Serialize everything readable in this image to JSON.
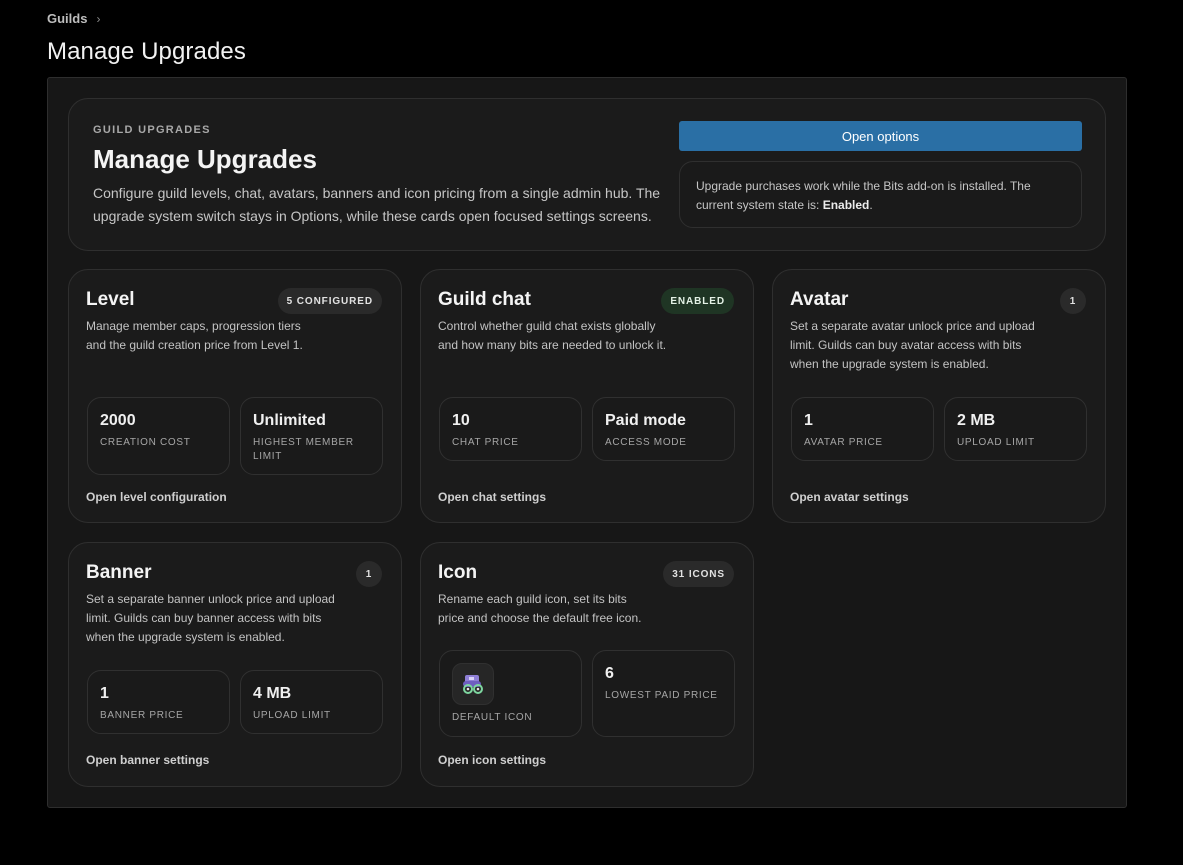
{
  "breadcrumb": {
    "root": "Guilds"
  },
  "page_title": "Manage Upgrades",
  "hero": {
    "eyebrow": "GUILD UPGRADES",
    "title": "Manage Upgrades",
    "description": "Configure guild levels, chat, avatars, banners and icon pricing from a single admin hub. The upgrade system switch stays in Options, while these cards open focused settings screens.",
    "options_button": "Open options",
    "state_text": "Upgrade purchases work while the Bits add-on is installed. The current system state is: ",
    "state_value": "Enabled",
    "state_suffix": "."
  },
  "cards": {
    "level": {
      "title": "Level",
      "badge": "5 CONFIGURED",
      "description": "Manage member caps, progression tiers and the guild creation price from Level 1.",
      "stat1_value": "2000",
      "stat1_label": "CREATION COST",
      "stat2_value": "Unlimited",
      "stat2_label": "HIGHEST MEMBER LIMIT",
      "link": "Open level configuration"
    },
    "chat": {
      "title": "Guild chat",
      "badge": "ENABLED",
      "description": "Control whether guild chat exists globally and how many bits are needed to unlock it.",
      "stat1_value": "10",
      "stat1_label": "CHAT PRICE",
      "stat2_value": "Paid mode",
      "stat2_label": "ACCESS MODE",
      "link": "Open chat settings"
    },
    "avatar": {
      "title": "Avatar",
      "badge": "1",
      "description": "Set a separate avatar unlock price and upload limit. Guilds can buy avatar access with bits when the upgrade system is enabled.",
      "stat1_value": "1",
      "stat1_label": "AVATAR PRICE",
      "stat2_value": "2 MB",
      "stat2_label": "UPLOAD LIMIT",
      "link": "Open avatar settings"
    },
    "banner": {
      "title": "Banner",
      "badge": "1",
      "description": "Set a separate banner unlock price and upload limit. Guilds can buy banner access with bits when the upgrade system is enabled.",
      "stat1_value": "1",
      "stat1_label": "BANNER PRICE",
      "stat2_value": "4 MB",
      "stat2_label": "UPLOAD LIMIT",
      "link": "Open banner settings"
    },
    "icon": {
      "title": "Icon",
      "badge": "31 ICONS",
      "description": "Rename each guild icon, set its bits price and choose the default free icon.",
      "stat1_label": "DEFAULT ICON",
      "stat2_value": "6",
      "stat2_label": "LOWEST PAID PRICE",
      "link": "Open icon settings"
    }
  },
  "icons": {
    "breadcrumb_separator": "chevron-right-icon",
    "default_icon": "guild-icon-purple-green"
  },
  "colors": {
    "accent_button": "#2a6fa5",
    "enabled_badge": "#1f3524",
    "background": "#000000",
    "panel": "#171717",
    "card": "#1b1b1b"
  }
}
